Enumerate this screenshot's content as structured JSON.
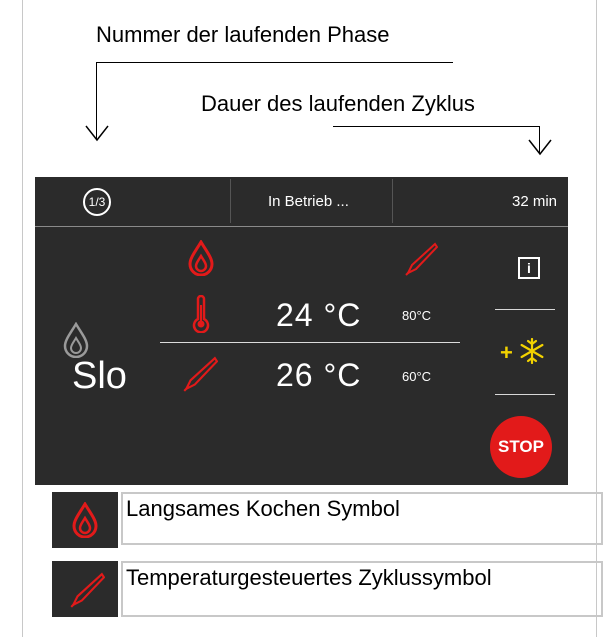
{
  "annotations": {
    "phase_number": "Nummer der laufenden Phase",
    "cycle_duration": "Dauer des laufenden Zyklus"
  },
  "header": {
    "phase": "1/3",
    "status": "In Betrieb ...",
    "duration": "32 min"
  },
  "readings": {
    "core_temp": "24 °C",
    "core_target": "80°C",
    "probe_temp": "26 °C",
    "probe_target": "60°C"
  },
  "mode_label": "Slo",
  "sidebar": {
    "info_label": "i",
    "plus_label": "+",
    "stop_label": "STOP"
  },
  "legend": [
    {
      "icon": "slow-cook-drop-icon",
      "text": "Langsames Kochen Symbol"
    },
    {
      "icon": "probe-icon",
      "text": "Temperaturgesteuertes Zyklussymbol"
    }
  ],
  "colors": {
    "screen_bg": "#2b2b2b",
    "accent_red": "#e21a1a",
    "accent_yellow": "#f2d200"
  }
}
